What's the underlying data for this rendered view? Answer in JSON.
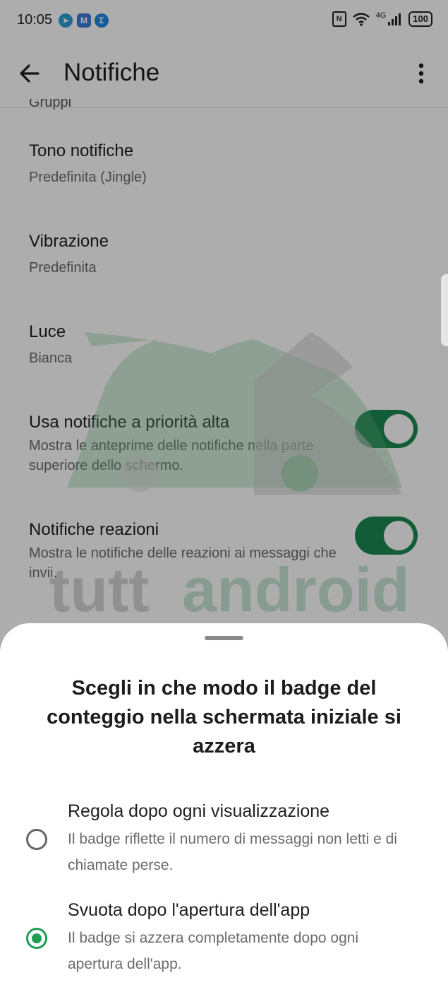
{
  "status_bar": {
    "time": "10:05",
    "app_icons": [
      "telegram-icon",
      "mail-icon",
      "sigma-icon"
    ],
    "network": "4G",
    "battery": "100"
  },
  "app_bar": {
    "title": "Notifiche"
  },
  "partial_section_label": "Gruppi",
  "settings": [
    {
      "title": "Tono notifiche",
      "subtitle": "Predefinita (Jingle)"
    },
    {
      "title": "Vibrazione",
      "subtitle": "Predefinita"
    },
    {
      "title": "Luce",
      "subtitle": "Bianca"
    },
    {
      "title": "Usa notifiche a priorità alta",
      "subtitle": "Mostra le anteprime delle notifiche nella parte superiore dello schermo.",
      "toggle_on": true
    },
    {
      "title": "Notifiche reazioni",
      "subtitle": "Mostra le notifiche delle reazioni ai messaggi che invii.",
      "toggle_on": true
    }
  ],
  "watermark": {
    "text_part1": "tutt",
    "text_part2": "android"
  },
  "sheet": {
    "title": "Scegli in che modo il badge del conteggio nella schermata iniziale si azzera",
    "options": [
      {
        "title": "Regola dopo ogni visualizzazione",
        "subtitle": "Il badge riflette il numero di messaggi non letti e di chiamate perse.",
        "selected": false
      },
      {
        "title": "Svuota dopo l'apertura dell'app",
        "subtitle": "Il badge si azzera completamente dopo ogni apertura dell'app.",
        "selected": true
      }
    ]
  },
  "colors": {
    "accent": "#1f9c55",
    "toggle": "#1b8a52",
    "scrim": "rgba(0,0,0,0.32)"
  }
}
